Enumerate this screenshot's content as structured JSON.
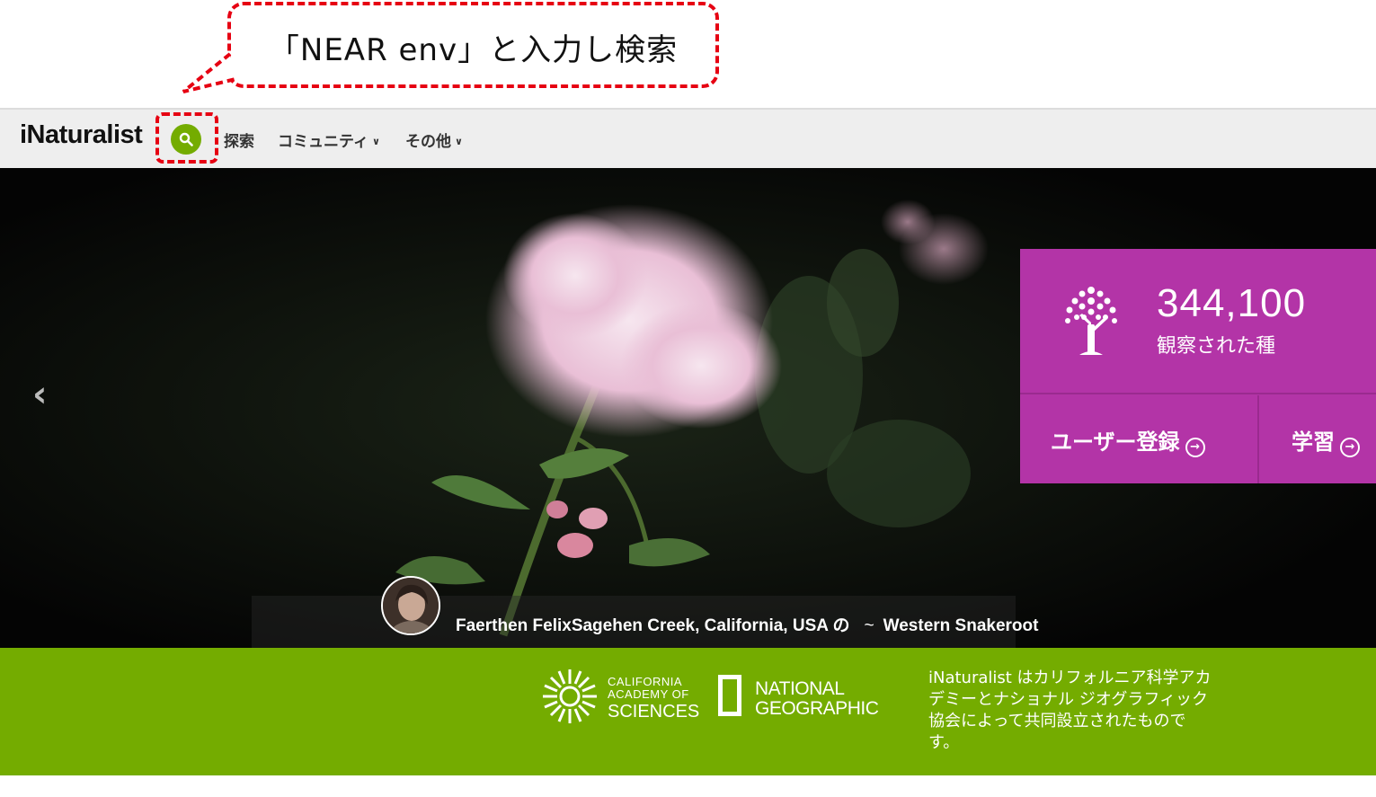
{
  "annotation": {
    "callout_text": "「NEAR env」と入力し検索"
  },
  "navbar": {
    "logo": "iNaturalist",
    "search_icon": "search-icon",
    "items": [
      {
        "label": "探索",
        "has_dropdown": false
      },
      {
        "label": "コミュニティ",
        "has_dropdown": true
      },
      {
        "label": "その他",
        "has_dropdown": true
      }
    ]
  },
  "hero": {
    "prev_arrow": "‹",
    "credit": {
      "observer_place": "Faerthen FelixSagehen Creek, California, USA の",
      "separator": "~",
      "species": "Western Snakeroot"
    }
  },
  "stats": {
    "species_count": "344,100",
    "species_label": "観察された種",
    "signup_label": "ユーザー登録",
    "learn_label": "学習",
    "arrow": "→"
  },
  "footer": {
    "cas_line1": "CALIFORNIA",
    "cas_line2": "ACADEMY OF",
    "cas_line3": "SCIENCES",
    "natgeo_line1": "NATIONAL",
    "natgeo_line2": "GEOGRAPHIC",
    "description": "iNaturalist はカリフォルニア科学アカデミーとナショナル ジオグラフィック協会によって共同設立されたものです。"
  },
  "colors": {
    "brand_green": "#74ac00",
    "stats_purple": "#b334a7",
    "annotation_red": "#e60012"
  }
}
